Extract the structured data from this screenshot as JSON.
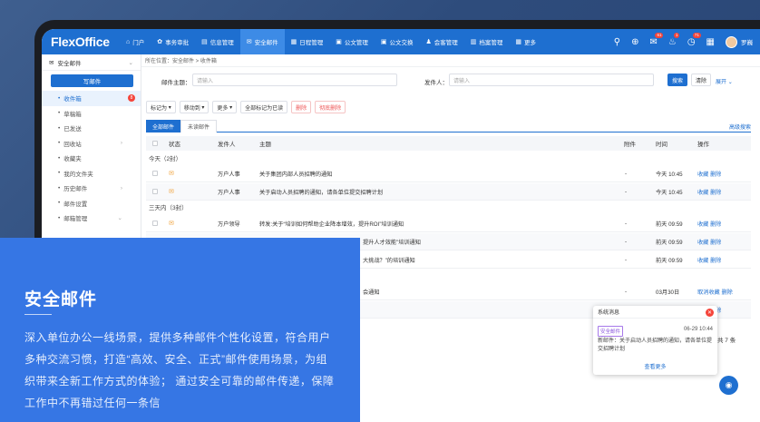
{
  "header": {
    "logo": "FlexOffice",
    "nav": [
      {
        "icon": "⌂",
        "label": "门户"
      },
      {
        "icon": "✿",
        "label": "事务审批"
      },
      {
        "icon": "▤",
        "label": "信息管理"
      },
      {
        "icon": "✉",
        "label": "安全邮件"
      },
      {
        "icon": "▦",
        "label": "日程管理"
      },
      {
        "icon": "▣",
        "label": "公文管理"
      },
      {
        "icon": "▣",
        "label": "公文交换"
      },
      {
        "icon": "♟",
        "label": "会客管理"
      },
      {
        "icon": "▥",
        "label": "档案管理"
      },
      {
        "icon": "▦",
        "label": "更多"
      }
    ],
    "badges": {
      "bell1": "61",
      "bell2": "1",
      "msg": "71"
    },
    "username": "罗巍"
  },
  "sidebar": {
    "title": "安全邮件",
    "write_label": "写邮件",
    "items": [
      {
        "label": "收件箱"
      },
      {
        "label": "草稿箱"
      },
      {
        "label": "已发送"
      },
      {
        "label": "回收站"
      },
      {
        "label": "收藏夹"
      },
      {
        "label": "我的文件夹"
      },
      {
        "label": "历史邮件"
      },
      {
        "label": "邮件设置"
      },
      {
        "label": "邮箱管理"
      }
    ],
    "inbox_badge": "8"
  },
  "breadcrumb": "所在位置：安全邮件 > 收件箱",
  "filter": {
    "subject_label": "邮件主题：",
    "subject_placeholder": "请输入",
    "sender_label": "发件人：",
    "sender_placeholder": "请输入",
    "search_label": "搜索",
    "clear_label": "清除",
    "expand_label": "展开"
  },
  "toolbar": {
    "mark_as": "标记为",
    "move_to": "移动到",
    "more": "更多",
    "mark_all_read": "全部标记为已读",
    "delete": "删除",
    "delete_forever": "彻底删除"
  },
  "tabs": {
    "all": "全部邮件",
    "unread": "未读邮件",
    "advanced": "高级搜索"
  },
  "table": {
    "headers": {
      "status": "状态",
      "sender": "发件人",
      "subject": "主题",
      "attach": "附件",
      "time": "时间",
      "ops": "操作"
    },
    "group_today": "今天（2封）",
    "group_3days": "三天内（3封）",
    "rows": [
      {
        "sender": "万户人事",
        "subject": "关于集团内部人员招聘的通知",
        "attach": "-",
        "time": "今天 10:45",
        "fav": "收藏",
        "del": "删除"
      },
      {
        "sender": "万户人事",
        "subject": "关于启动人员招聘的通知，请各单位提交招聘计划",
        "attach": "-",
        "time": "今天 10:45",
        "fav": "收藏",
        "del": "删除"
      },
      {
        "sender": "万户领导",
        "subject": "转发:关于“培训如何帮助企业降本增效，提升ROI”培训通知",
        "attach": "-",
        "time": "前天 09:59",
        "fav": "收藏",
        "del": "删除"
      },
      {
        "sender": "",
        "subject": "提升人才效能”培训通知",
        "attach": "-",
        "time": "前天 09:59",
        "fav": "收藏",
        "del": "删除"
      },
      {
        "sender": "",
        "subject": "大挑战？”的培训通知",
        "attach": "-",
        "time": "前天 09:59",
        "fav": "收藏",
        "del": "删除"
      },
      {
        "sender": "",
        "subject": "会通知",
        "attach": "-",
        "time": "03月30日",
        "fav": "取消收藏",
        "del": "删除"
      },
      {
        "sender": "",
        "subject": "",
        "attach": "",
        "time": "",
        "fav": "收藏",
        "del": "删除"
      }
    ]
  },
  "pager": "共 7 条",
  "popup": {
    "title": "系统消息",
    "tag": "安全邮件",
    "time": "06-29 10:44",
    "body": "新邮件：关于启动人员招聘的通知，请各单位提交招聘计划",
    "more": "查看更多"
  },
  "overlay": {
    "title": "安全邮件",
    "text": "深入单位办公一线场景，提供多种邮件个性化设置，符合用户多种交流习惯，打造“高效、安全、正式”邮件使用场景，为组织带来全新工作方式的体验； 通过安全可靠的邮件传递，保障工作中不再错过任何一条信"
  }
}
